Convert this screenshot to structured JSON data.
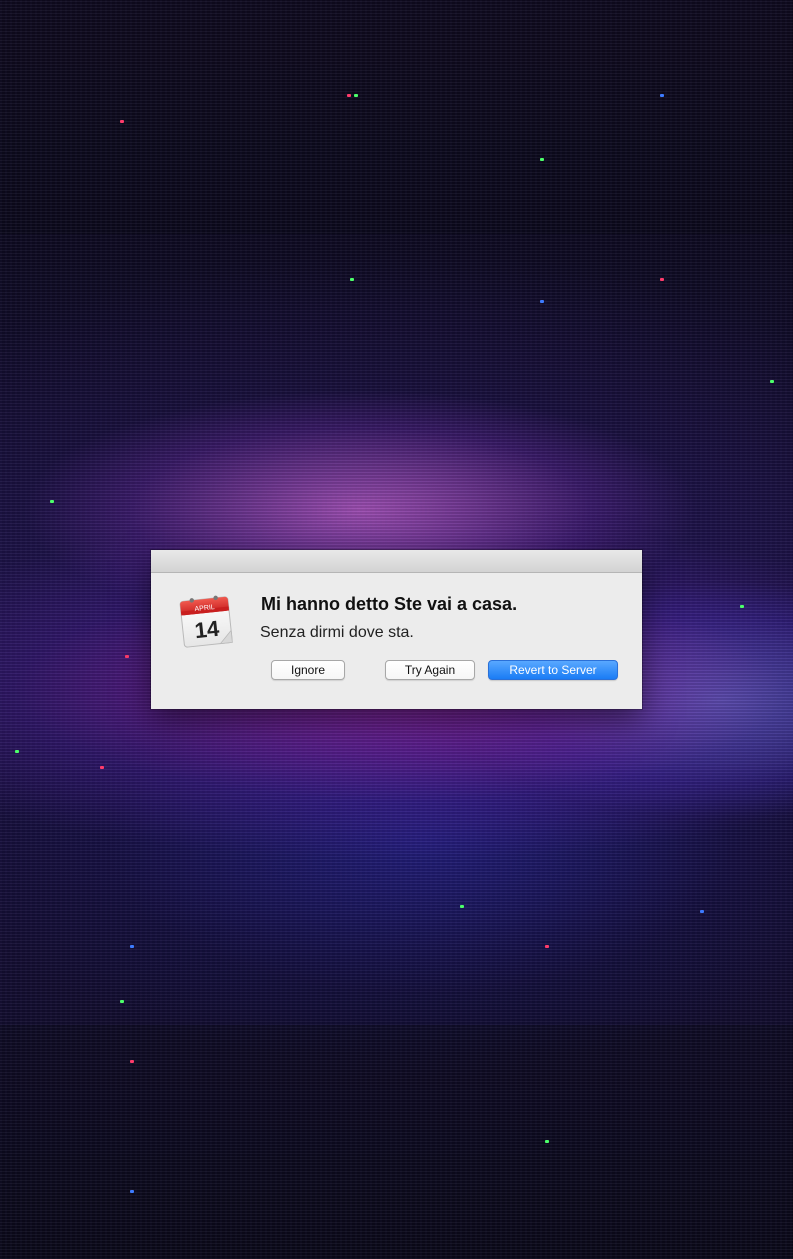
{
  "dialog": {
    "title": "Mi hanno detto Ste vai a casa.",
    "message": "Senza dirmi dove sta.",
    "icon": "calendar-icon",
    "calendar_month": "APRIL",
    "calendar_day": "14",
    "buttons": {
      "ignore": "Ignore",
      "try_again": "Try Again",
      "revert": "Revert to Server"
    },
    "default_button_color": "#1a7cf5"
  },
  "desktop": {
    "wallpaper": "glitched purple nebula"
  }
}
